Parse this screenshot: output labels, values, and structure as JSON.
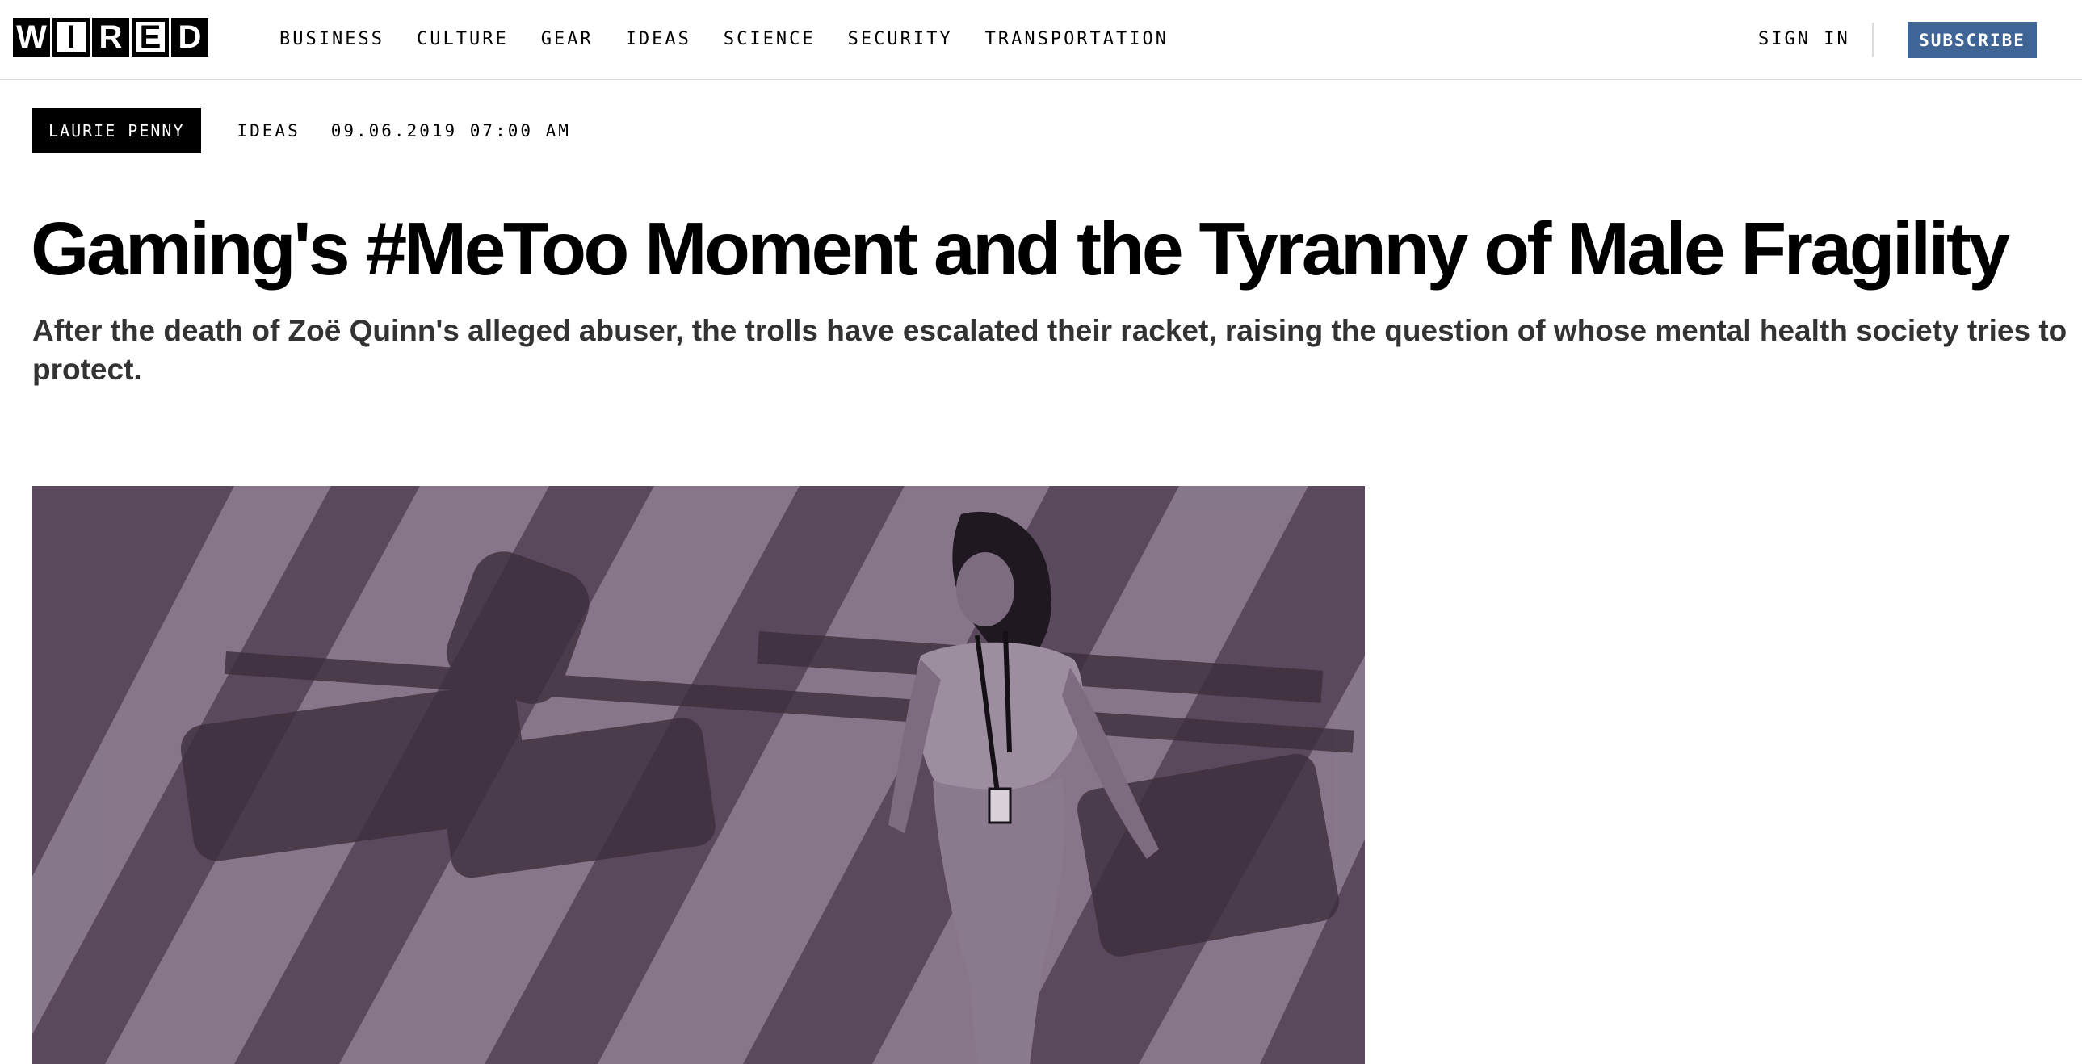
{
  "nav": {
    "logo_letters": [
      "W",
      "I",
      "R",
      "E",
      "D"
    ],
    "links": [
      "BUSINESS",
      "CULTURE",
      "GEAR",
      "IDEAS",
      "SCIENCE",
      "SECURITY",
      "TRANSPORTATION"
    ],
    "sign_in": "SIGN IN",
    "subscribe": "SUBSCRIBE",
    "subscribe_color": "#3f6597"
  },
  "article": {
    "author": "LAURIE PENNY",
    "category": "IDEAS",
    "date": "09.06.2019 07:00 AM",
    "title": "Gaming's #MeToo Moment and the Tyranny of Male Fragility",
    "dek": "After the death of Zoë Quinn's alleged abuser, the trolls have escalated their racket, raising the question of whose mental health society tries to protect."
  },
  "hero_image": {
    "tint": "#5d4b5f"
  }
}
